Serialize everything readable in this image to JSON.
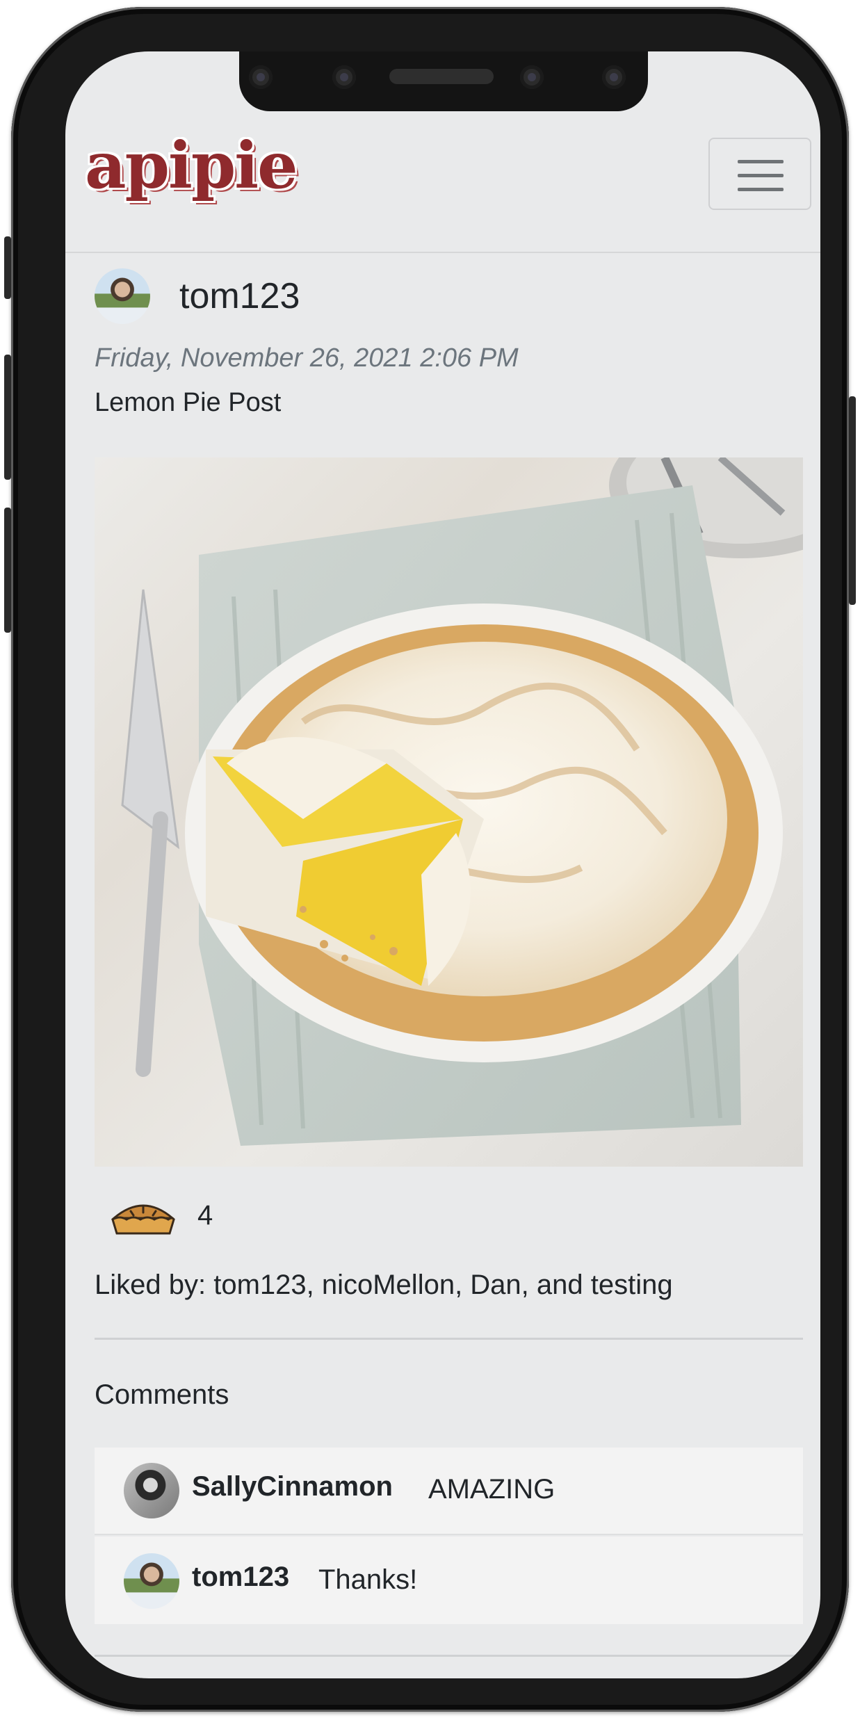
{
  "app": {
    "logo_text": "apipie"
  },
  "post": {
    "username": "tom123",
    "date": "Friday, November 26, 2021 2:06 PM",
    "title": "Lemon Pie Post",
    "like_count": "4",
    "liked_by_text": "Liked by: tom123, nicoMellon, Dan, and testing"
  },
  "comments": {
    "heading": "Comments",
    "items": [
      {
        "username": "SallyCinnamon",
        "text": "AMAZING"
      },
      {
        "username": "tom123",
        "text": "Thanks!"
      }
    ]
  },
  "colors": {
    "logo": "#8f2a2d",
    "screen_background": "#e9eaeb",
    "comment_background": "#f3f3f3",
    "meringue": "#f7f1e4",
    "lemon_filling": "#f2d33d",
    "crust": "#d9a862"
  },
  "icons": {
    "like": "pie-icon",
    "menu": "hamburger-menu-icon"
  }
}
